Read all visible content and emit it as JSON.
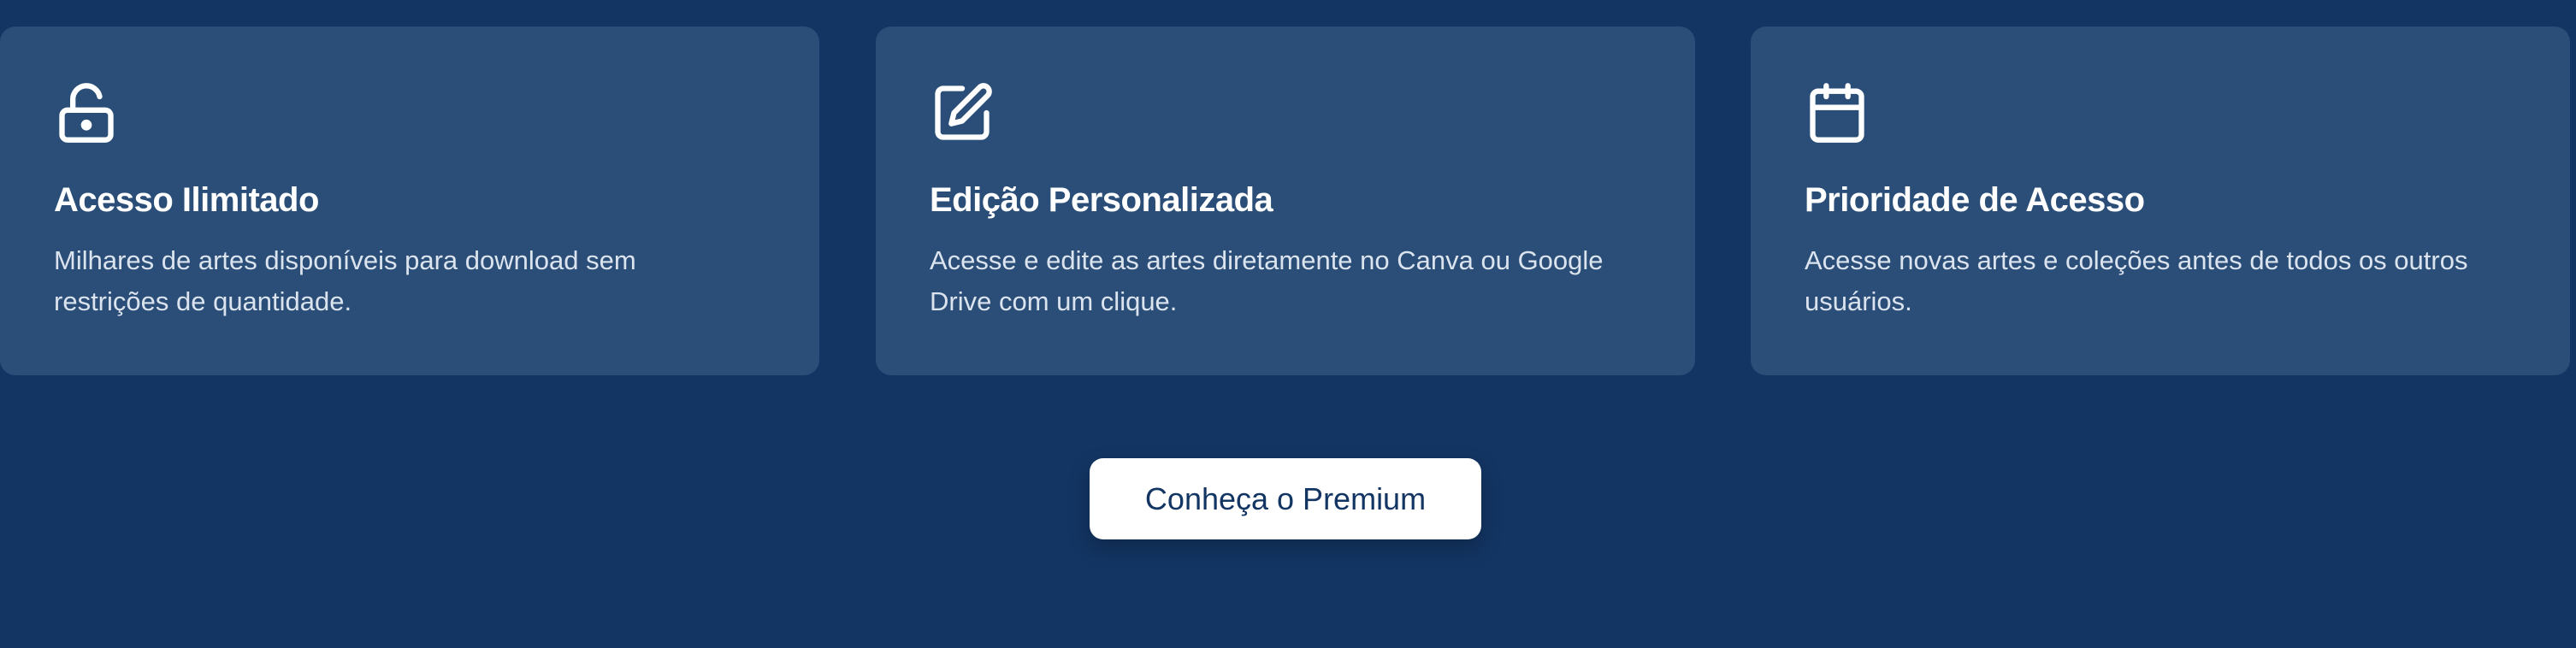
{
  "features": [
    {
      "icon": "unlock-icon",
      "title": "Acesso Ilimitado",
      "description": "Milhares de artes disponíveis para download sem restrições de quantidade."
    },
    {
      "icon": "edit-icon",
      "title": "Edição Personalizada",
      "description": "Acesse e edite as artes diretamente no Canva ou Google Drive com um clique."
    },
    {
      "icon": "calendar-icon",
      "title": "Prioridade de Acesso",
      "description": "Acesse novas artes e coleções antes de todos os outros usuários."
    }
  ],
  "cta": {
    "label": "Conheça o Premium"
  },
  "colors": {
    "background": "#133563",
    "card": "#2a4e77",
    "button": "#ffffff",
    "button_text": "#133563"
  }
}
